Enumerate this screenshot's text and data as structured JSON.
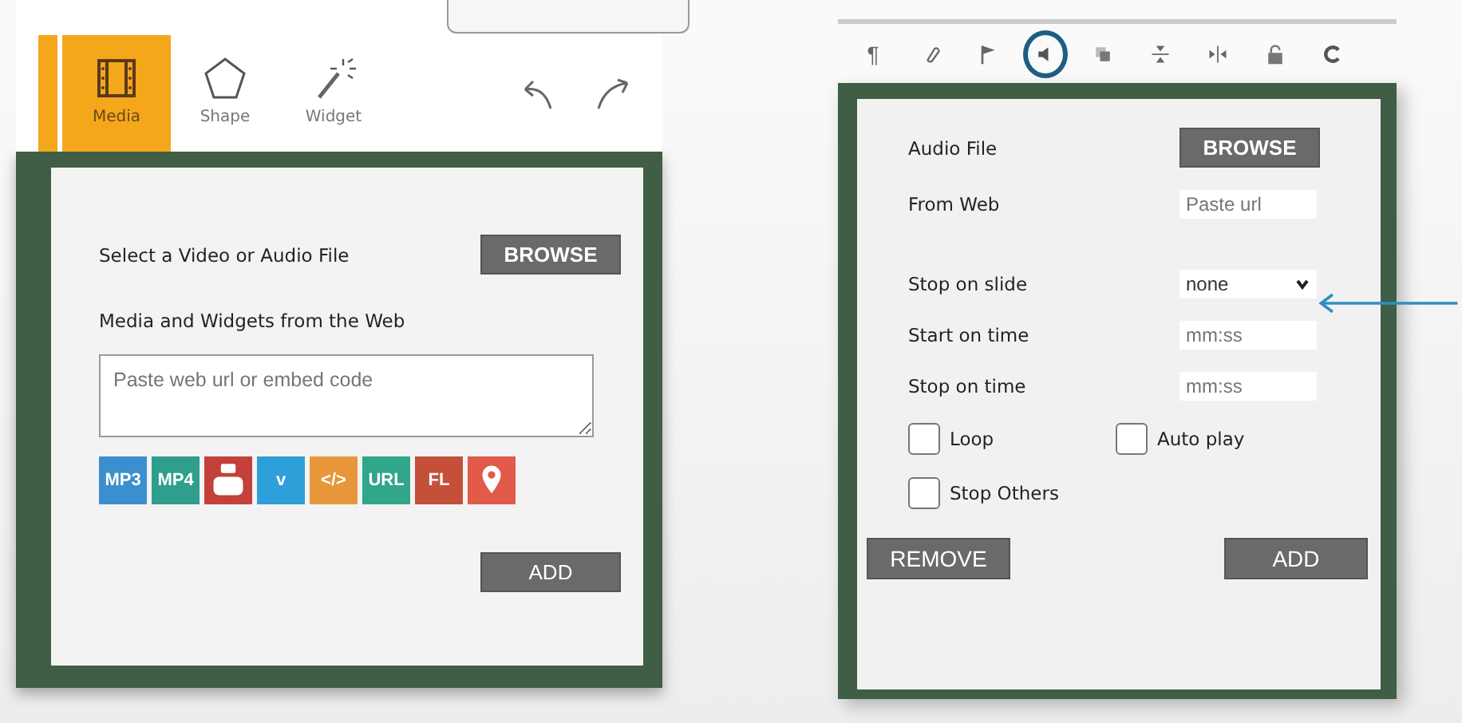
{
  "left_panel": {
    "tabs": [
      {
        "kind": "media",
        "label": "Media",
        "selected": true
      },
      {
        "kind": "shape",
        "label": "Shape",
        "selected": false
      },
      {
        "kind": "widget",
        "label": "Widget",
        "selected": false
      }
    ],
    "select_label": "Select a Video or Audio File",
    "browse_button": "BROWSE",
    "web_label": "Media and Widgets from the Web",
    "embed_field": {
      "placeholder": "Paste web url or embed code"
    },
    "sources": [
      {
        "kind": "text",
        "label": "MP3",
        "color": "#3b8fcf"
      },
      {
        "kind": "text",
        "label": "MP4",
        "color": "#2f9e8c"
      },
      {
        "kind": "youtube",
        "color": "#c4403a"
      },
      {
        "kind": "text",
        "label": "v",
        "color": "#2e9fd8"
      },
      {
        "kind": "text",
        "label": "</>",
        "color": "#e8963a"
      },
      {
        "kind": "text",
        "label": "URL",
        "color": "#31a68a"
      },
      {
        "kind": "text",
        "label": "FL",
        "color": "#c4503a"
      },
      {
        "kind": "pin",
        "color": "#e25a4a"
      }
    ],
    "add_button": "ADD"
  },
  "right_panel": {
    "toolbar": [
      {
        "kind": "pilcrow",
        "label": "¶",
        "selected": false
      },
      {
        "kind": "link",
        "selected": false
      },
      {
        "kind": "flag",
        "selected": false
      },
      {
        "kind": "speaker",
        "selected": true
      },
      {
        "kind": "layers",
        "selected": false
      },
      {
        "kind": "vcenter",
        "selected": false
      },
      {
        "kind": "hcenter",
        "selected": false
      },
      {
        "kind": "lock",
        "selected": false
      },
      {
        "kind": "refresh",
        "selected": false
      }
    ],
    "audio_file_label": "Audio File",
    "browse_button": "BROWSE",
    "from_web_label": "From Web",
    "url_field": {
      "placeholder": "Paste url"
    },
    "stop_on_slide": {
      "label": "Stop on slide",
      "value": "none"
    },
    "start_time": {
      "label": "Start on time",
      "placeholder": "mm:ss"
    },
    "stop_time": {
      "label": "Stop on time",
      "placeholder": "mm:ss"
    },
    "options": [
      {
        "label": "Loop",
        "checked": false
      },
      {
        "label": "Auto play",
        "checked": false
      },
      {
        "label": "Stop Others",
        "checked": false
      }
    ],
    "remove_button": "REMOVE",
    "add_button": "ADD"
  }
}
